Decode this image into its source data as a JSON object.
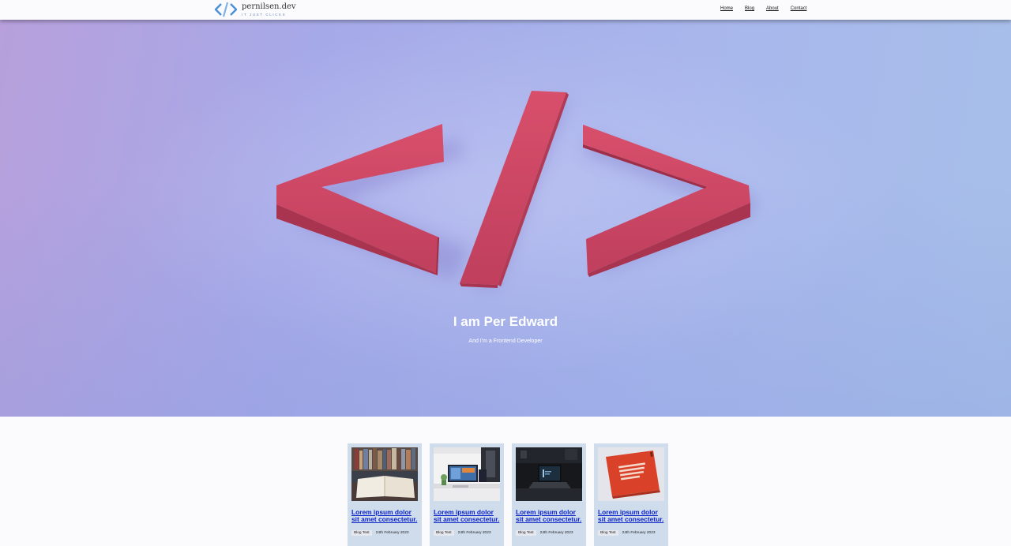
{
  "header": {
    "logo_title": "pernilsen.dev",
    "logo_tagline": "IT JUST CLICKS",
    "nav": [
      "Home",
      "Blog",
      "About",
      "Contact"
    ]
  },
  "hero": {
    "title": "I am Per Edward",
    "subtitle": "And I'm a Frontend Developer",
    "art_color": "#c8445f"
  },
  "posts": [
    {
      "title": "Lorem ipsum dolor sit amet consectetur.",
      "tag": "Blog Test",
      "date": "24th February 2023"
    },
    {
      "title": "Lorem ipsum dolor sit amet consectetur.",
      "tag": "Blog Test",
      "date": "24th February 2023"
    },
    {
      "title": "Lorem ipsum dolor sit amet consectetur.",
      "tag": "Blog Test",
      "date": "24th February 2023"
    },
    {
      "title": "Lorem ipsum dolor sit amet consectetur.",
      "tag": "Blog Test",
      "date": "24th February 2023"
    }
  ],
  "colors": {
    "accent": "#4a90d9",
    "link": "#0b23c9",
    "card_bg": "#cfdcec"
  }
}
